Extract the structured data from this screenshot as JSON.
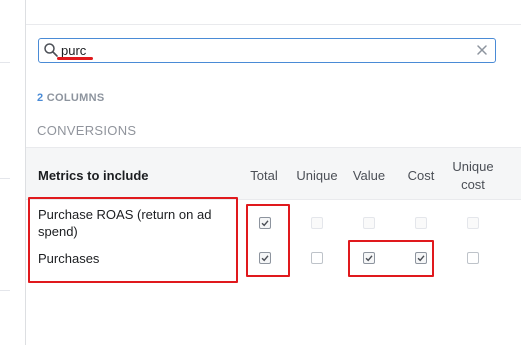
{
  "search": {
    "value": "purc"
  },
  "column_count": {
    "number": "2",
    "label": " COLUMNS"
  },
  "section_title": "CONVERSIONS",
  "table": {
    "header": {
      "metrics_label": "Metrics to include",
      "columns": [
        "Total",
        "Unique",
        "Value",
        "Cost",
        "Unique cost"
      ]
    },
    "rows": [
      {
        "label": "Purchase ROAS (return on ad spend)",
        "checks": {
          "total": true,
          "unique": false,
          "value": false,
          "cost": false,
          "unique_cost": false
        },
        "enabled": {
          "total": true,
          "unique": false,
          "value": false,
          "cost": false,
          "unique_cost": false
        }
      },
      {
        "label": "Purchases",
        "checks": {
          "total": true,
          "unique": false,
          "value": true,
          "cost": true,
          "unique_cost": false
        },
        "enabled": {
          "total": true,
          "unique": true,
          "value": true,
          "cost": true,
          "unique_cost": true
        }
      }
    ]
  },
  "colors": {
    "accent": "#4a8bd6",
    "annotation_red": "#e0191d"
  },
  "icons": {
    "search": "search-icon",
    "clear": "close-icon",
    "check": "checkmark-icon"
  }
}
